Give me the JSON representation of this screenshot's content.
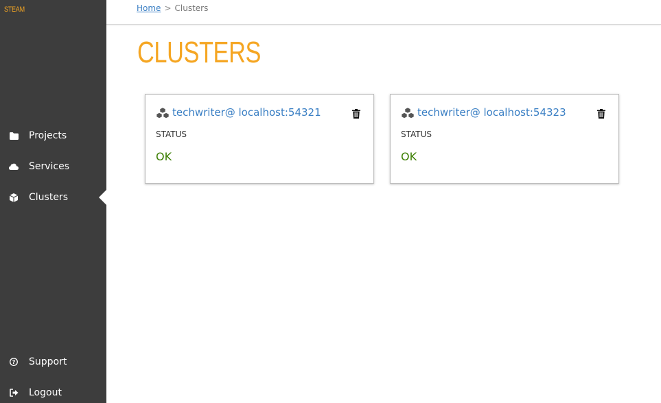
{
  "app": {
    "logo": "STEAM"
  },
  "sidebar": {
    "items": [
      {
        "label": "Projects",
        "icon": "folder-icon"
      },
      {
        "label": "Services",
        "icon": "cloud-icon"
      },
      {
        "label": "Clusters",
        "icon": "cube-icon",
        "active": true
      },
      {
        "label": "Support",
        "icon": "question-circle-icon"
      },
      {
        "label": "Logout",
        "icon": "sign-out-icon"
      }
    ]
  },
  "breadcrumb": {
    "home": "Home",
    "separator": ">",
    "current": "Clusters"
  },
  "page": {
    "title": "CLUSTERS"
  },
  "clusters": [
    {
      "name": "techwriter@ localhost:54321",
      "status_label": "STATUS",
      "status": "OK"
    },
    {
      "name": "techwriter@ localhost:54323",
      "status_label": "STATUS",
      "status": "OK"
    }
  ],
  "colors": {
    "accent": "#f5a623",
    "sidebar_bg": "#3d3d3d",
    "link": "#3a7fc4",
    "status_ok": "#3a7d00"
  }
}
